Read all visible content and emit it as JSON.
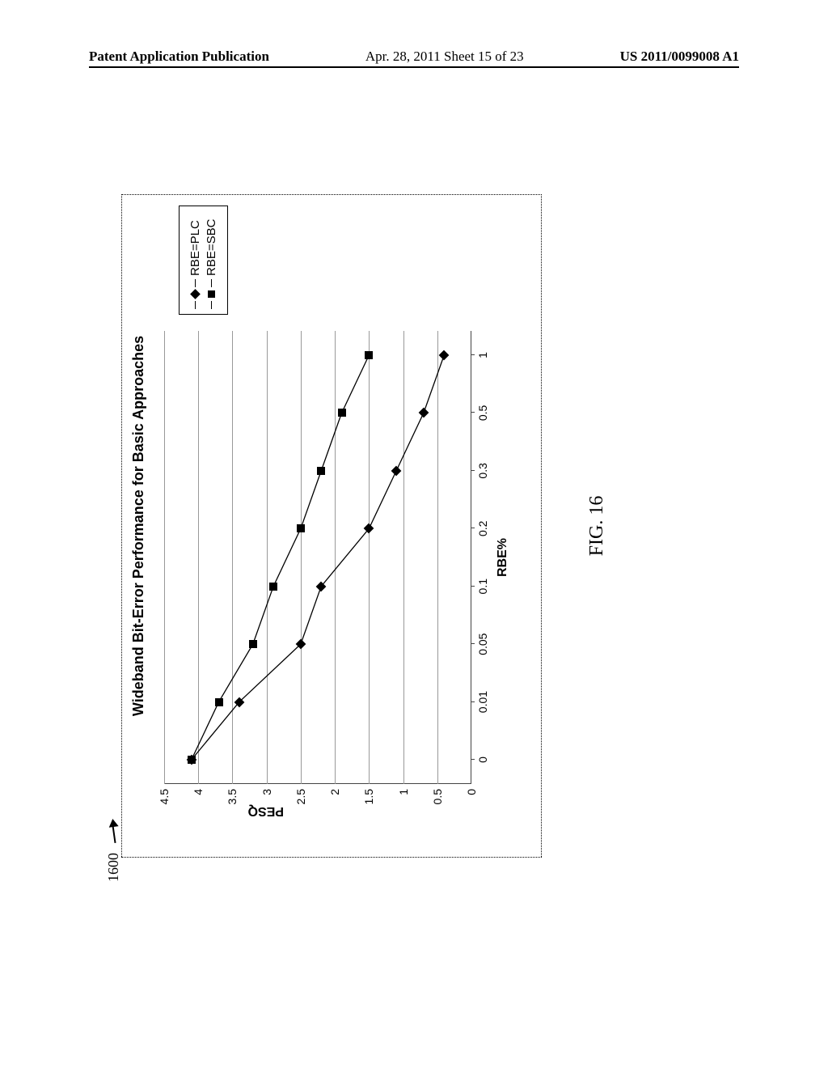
{
  "header": {
    "left": "Patent Application Publication",
    "mid": "Apr. 28, 2011  Sheet 15 of 23",
    "right": "US 2011/0099008 A1"
  },
  "figure": {
    "label": "1600",
    "caption": "FIG. 16"
  },
  "legend": {
    "items": [
      {
        "marker": "diamond",
        "label": "RBE=PLC"
      },
      {
        "marker": "square",
        "label": "RBE=SBC"
      }
    ]
  },
  "chart_data": {
    "type": "line",
    "title": "Wideband Bit-Error Performance for Basic Approaches",
    "xlabel": "RBE%",
    "ylabel": "PESQ",
    "ylim": [
      0,
      4.5
    ],
    "yticks": [
      0,
      0.5,
      1,
      1.5,
      2,
      2.5,
      3,
      3.5,
      4,
      4.5
    ],
    "categories": [
      "0",
      "0.01",
      "0.05",
      "0.1",
      "0.2",
      "0.3",
      "0.5",
      "1"
    ],
    "series": [
      {
        "name": "RBE=PLC",
        "marker": "diamond",
        "values": [
          4.1,
          3.4,
          2.5,
          2.2,
          1.5,
          1.1,
          0.7,
          0.4
        ]
      },
      {
        "name": "RBE=SBC",
        "marker": "square",
        "values": [
          4.1,
          3.7,
          3.2,
          2.9,
          2.5,
          2.2,
          1.9,
          1.5
        ]
      }
    ]
  }
}
